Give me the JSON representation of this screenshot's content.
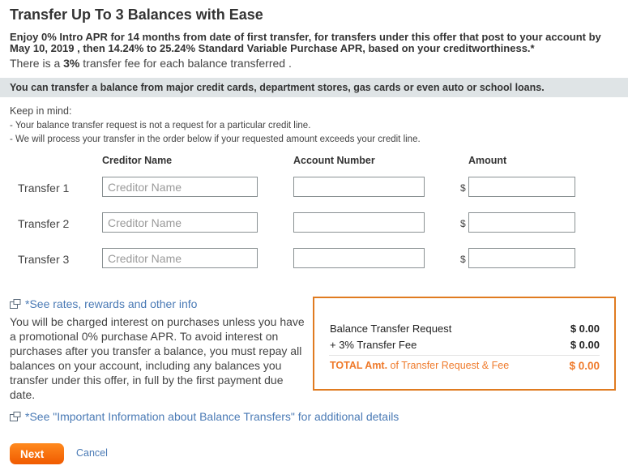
{
  "header": {
    "title": "Transfer Up To 3 Balances with Ease",
    "offer_line1": "Enjoy 0% Intro APR for 14 months from date of first transfer, for transfers under this offer that post to your account by",
    "offer_line2": "May 10, 2019 , then 14.24% to 25.24% Standard Variable Purchase APR, based on your creditworthiness.*",
    "fee_prefix": "There is a ",
    "fee_value": "3%",
    "fee_suffix": " transfer fee for each balance transferred ."
  },
  "banner": {
    "text": "You can transfer a balance from major credit cards, department stores, gas cards or even auto or school loans."
  },
  "keep_in_mind": {
    "heading": "Keep in mind:",
    "items": [
      "- Your balance transfer request is not a request for a particular credit line.",
      "- We will process your transfer in the order below if your requested amount exceeds your credit line."
    ]
  },
  "form": {
    "columns": {
      "creditor": "Creditor Name",
      "account": "Account Number",
      "amount": "Amount"
    },
    "currency_symbol": "$",
    "rows": [
      {
        "label": "Transfer 1",
        "creditor_placeholder": "Creditor Name",
        "creditor_value": "",
        "account_value": "",
        "amount_value": ""
      },
      {
        "label": "Transfer 2",
        "creditor_placeholder": "Creditor Name",
        "creditor_value": "",
        "account_value": "",
        "amount_value": ""
      },
      {
        "label": "Transfer 3",
        "creditor_placeholder": "Creditor Name",
        "creditor_value": "",
        "account_value": "",
        "amount_value": ""
      }
    ]
  },
  "links": {
    "rates": "*See rates, rewards and other info",
    "important_info": "*See \"Important Information about Balance Transfers\" for additional details"
  },
  "disclaimer": "You will be charged interest on purchases unless you have a promotional 0% purchase APR. To avoid interest on purchases after you transfer a balance, you must repay all balances on your account, including any balances you transfer under this offer, in full by the first payment due date.",
  "summary": {
    "request_label": "Balance Transfer Request",
    "request_value": "$ 0.00",
    "fee_label": "+ 3% Transfer Fee",
    "fee_value": "$ 0.00",
    "total_label_bold": "TOTAL Amt.",
    "total_label_rest": " of Transfer Request & Fee",
    "total_value": "$ 0.00"
  },
  "actions": {
    "next": "Next",
    "cancel": "Cancel"
  },
  "colors": {
    "accent_orange": "#f05a00",
    "summary_border": "#e07b20",
    "link_blue": "#4a7ab5",
    "banner_bg": "#dfe4e6"
  }
}
